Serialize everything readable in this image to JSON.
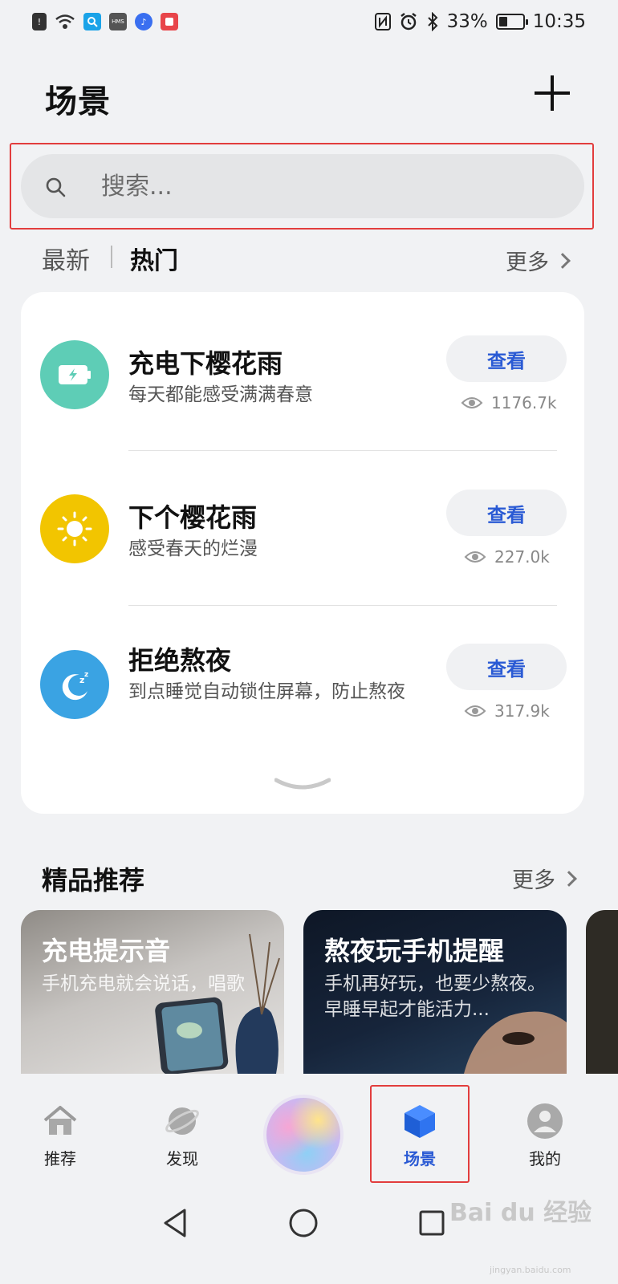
{
  "status_bar": {
    "battery": "33%",
    "time": "10:35",
    "hms": "HMS"
  },
  "header": {
    "title": "场景",
    "add_icon": "plus-icon"
  },
  "search": {
    "placeholder": "搜索..."
  },
  "tabs": {
    "latest": "最新",
    "hot": "热门",
    "more": "更多"
  },
  "scenes": [
    {
      "title": "充电下樱花雨",
      "subtitle": "每天都能感受满满春意",
      "button": "查看",
      "views": "1176.7k",
      "icon": "battery-charging-icon",
      "color": "#5ecdb6"
    },
    {
      "title": "下个樱花雨",
      "subtitle": "感受春天的烂漫",
      "button": "查看",
      "views": "227.0k",
      "icon": "sun-icon",
      "color": "#f2c500"
    },
    {
      "title": "拒绝熬夜",
      "subtitle": "到点睡觉自动锁住屏幕，防止熬夜",
      "button": "查看",
      "views": "317.9k",
      "icon": "moon-sleep-icon",
      "color": "#3aa3e3"
    }
  ],
  "featured": {
    "title": "精品推荐",
    "more": "更多",
    "items": [
      {
        "name": "充电提示音",
        "desc": "手机充电就会说话，唱歌"
      },
      {
        "name": "熬夜玩手机提醒",
        "desc": "手机再好玩，也要少熬夜。早睡早起才能活力..."
      }
    ]
  },
  "nav": {
    "recommend": "推荐",
    "discover": "发现",
    "scenes": "场景",
    "mine": "我的"
  },
  "accent": "#2a5ad4",
  "watermark": {
    "brand": "Bai du 经验",
    "url": "jingyan.baidu.com"
  }
}
